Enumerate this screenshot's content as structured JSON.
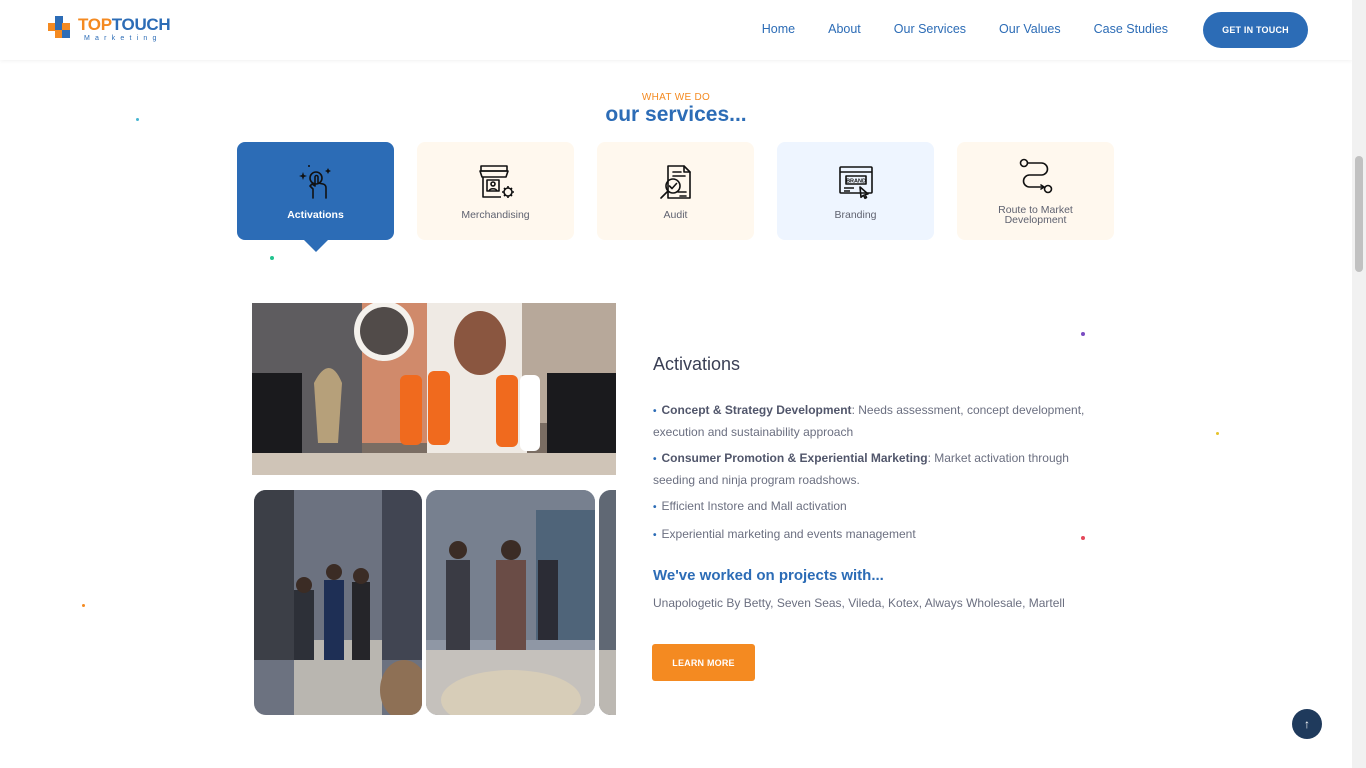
{
  "brand": {
    "top": "TOP",
    "touch": "TOUCH",
    "sub": "Marketing"
  },
  "nav": [
    "Home",
    "About",
    "Our Services",
    "Our Values",
    "Case Studies"
  ],
  "cta": "GET IN TOUCH",
  "section": {
    "eyebrow": "WHAT WE DO",
    "title": "our services..."
  },
  "tabs": [
    {
      "label": "Activations",
      "icon": "touch-hand-icon",
      "active": true
    },
    {
      "label": "Merchandising",
      "icon": "storefront-gear-icon",
      "active": false
    },
    {
      "label": "Audit",
      "icon": "document-magnifier-icon",
      "active": false
    },
    {
      "label": "Branding",
      "icon": "brand-browser-icon",
      "active": false
    },
    {
      "label": "Route to Market Development",
      "icon": "route-path-icon",
      "active": false
    }
  ],
  "content": {
    "title": "Activations",
    "bullets": [
      {
        "strong": "Concept & Strategy Development",
        "text": ": Needs assessment, concept development, execution and sustainability approach"
      },
      {
        "strong": "Consumer Promotion & Experiential Marketing",
        "text": ": Market activation through seeding and ninja program roadshows."
      },
      {
        "strong": "",
        "text": "Efficient Instore and Mall activation"
      },
      {
        "strong": "",
        "text": "Experiential marketing and events management"
      }
    ],
    "projects_title": "We've worked on projects with...",
    "projects_text": "Unapologetic By Betty, Seven Seas, Vileda, Kotex, Always Wholesale, Martell",
    "learn_more": "LEARN MORE"
  },
  "colors": {
    "primary": "#2c6cb6",
    "accent": "#f48a21",
    "dark": "#3a3f55"
  },
  "back_to_top": "↑"
}
